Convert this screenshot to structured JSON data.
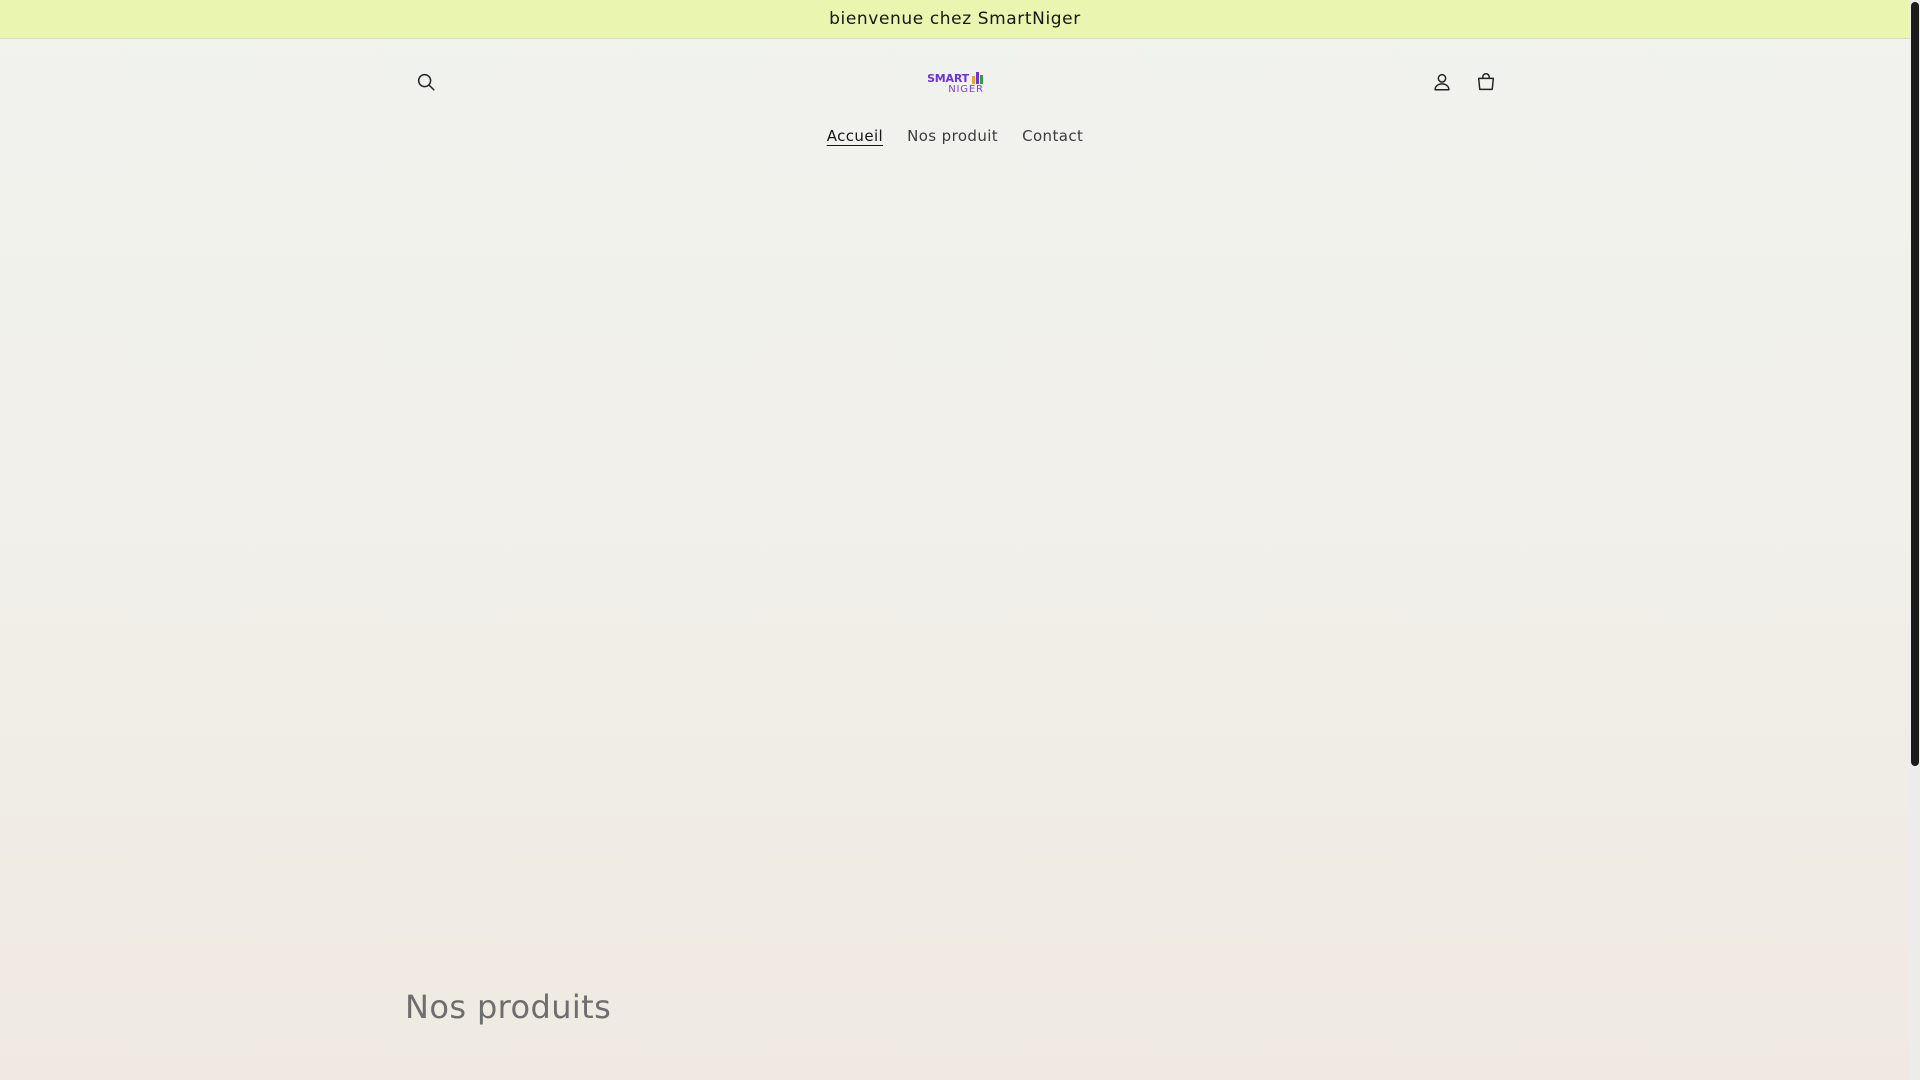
{
  "announcement": {
    "text": "bienvenue chez SmartNiger"
  },
  "header": {
    "logo": {
      "line1": "SMART",
      "line2": "NIGER"
    },
    "icons": {
      "search": "search-icon",
      "account": "account-icon",
      "cart": "cart-icon"
    }
  },
  "nav": {
    "items": [
      {
        "label": "Accueil",
        "active": true
      },
      {
        "label": "Nos produit",
        "active": false
      },
      {
        "label": "Contact",
        "active": false
      }
    ]
  },
  "products": {
    "title": "Nos produits"
  },
  "colors": {
    "announcement_bg": "#eaf6b0",
    "logo_purple": "#6b34d6",
    "logo_accent_orange": "#f0a030",
    "logo_accent_green": "#2f9e44"
  }
}
